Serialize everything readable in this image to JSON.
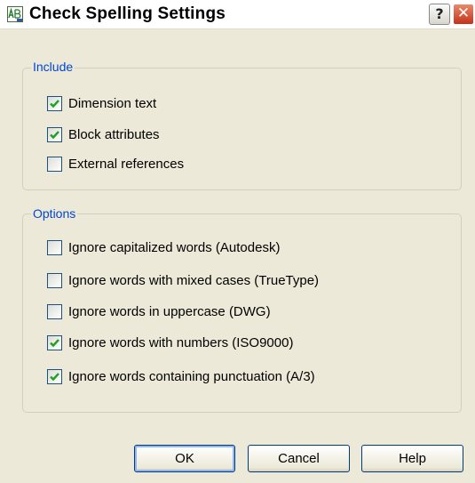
{
  "window": {
    "title": "Check Spelling Settings",
    "help_glyph": "?",
    "close_glyph": "✕"
  },
  "include": {
    "legend": "Include",
    "items": [
      {
        "label": "Dimension text",
        "checked": true
      },
      {
        "label": "Block attributes",
        "checked": true
      },
      {
        "label": "External references",
        "checked": false
      }
    ]
  },
  "options": {
    "legend": "Options",
    "items": [
      {
        "label": "Ignore capitalized words (Autodesk)",
        "checked": false
      },
      {
        "label": "Ignore words with mixed cases (TrueType)",
        "checked": false
      },
      {
        "label": "Ignore words in uppercase (DWG)",
        "checked": false
      },
      {
        "label": "Ignore words with numbers (ISO9000)",
        "checked": true
      },
      {
        "label": "Ignore words containing punctuation (A/3)",
        "checked": true
      }
    ]
  },
  "buttons": {
    "ok": "OK",
    "cancel": "Cancel",
    "help": "Help"
  },
  "colors": {
    "dialog_background": "#ece9d8",
    "group_legend": "#0046d5",
    "check_mark": "#21a121",
    "close_button": "#c4321a"
  },
  "icons": {
    "app": "spell-check-icon",
    "help": "help-icon",
    "close": "close-icon",
    "check": "checkmark-icon"
  }
}
